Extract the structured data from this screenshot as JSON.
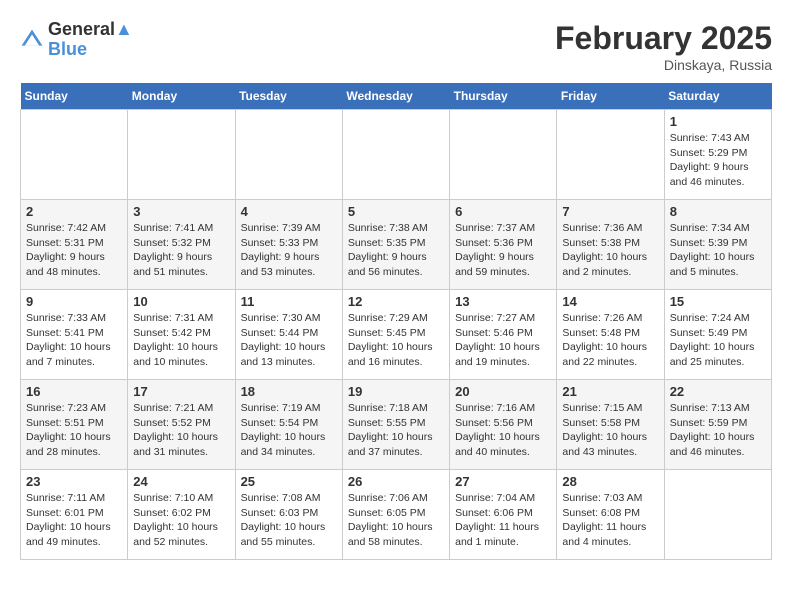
{
  "header": {
    "logo_line1": "General",
    "logo_line2": "Blue",
    "month": "February 2025",
    "location": "Dinskaya, Russia"
  },
  "days_of_week": [
    "Sunday",
    "Monday",
    "Tuesday",
    "Wednesday",
    "Thursday",
    "Friday",
    "Saturday"
  ],
  "weeks": [
    [
      {
        "day": "",
        "info": ""
      },
      {
        "day": "",
        "info": ""
      },
      {
        "day": "",
        "info": ""
      },
      {
        "day": "",
        "info": ""
      },
      {
        "day": "",
        "info": ""
      },
      {
        "day": "",
        "info": ""
      },
      {
        "day": "1",
        "info": "Sunrise: 7:43 AM\nSunset: 5:29 PM\nDaylight: 9 hours and 46 minutes."
      }
    ],
    [
      {
        "day": "2",
        "info": "Sunrise: 7:42 AM\nSunset: 5:31 PM\nDaylight: 9 hours and 48 minutes."
      },
      {
        "day": "3",
        "info": "Sunrise: 7:41 AM\nSunset: 5:32 PM\nDaylight: 9 hours and 51 minutes."
      },
      {
        "day": "4",
        "info": "Sunrise: 7:39 AM\nSunset: 5:33 PM\nDaylight: 9 hours and 53 minutes."
      },
      {
        "day": "5",
        "info": "Sunrise: 7:38 AM\nSunset: 5:35 PM\nDaylight: 9 hours and 56 minutes."
      },
      {
        "day": "6",
        "info": "Sunrise: 7:37 AM\nSunset: 5:36 PM\nDaylight: 9 hours and 59 minutes."
      },
      {
        "day": "7",
        "info": "Sunrise: 7:36 AM\nSunset: 5:38 PM\nDaylight: 10 hours and 2 minutes."
      },
      {
        "day": "8",
        "info": "Sunrise: 7:34 AM\nSunset: 5:39 PM\nDaylight: 10 hours and 5 minutes."
      }
    ],
    [
      {
        "day": "9",
        "info": "Sunrise: 7:33 AM\nSunset: 5:41 PM\nDaylight: 10 hours and 7 minutes."
      },
      {
        "day": "10",
        "info": "Sunrise: 7:31 AM\nSunset: 5:42 PM\nDaylight: 10 hours and 10 minutes."
      },
      {
        "day": "11",
        "info": "Sunrise: 7:30 AM\nSunset: 5:44 PM\nDaylight: 10 hours and 13 minutes."
      },
      {
        "day": "12",
        "info": "Sunrise: 7:29 AM\nSunset: 5:45 PM\nDaylight: 10 hours and 16 minutes."
      },
      {
        "day": "13",
        "info": "Sunrise: 7:27 AM\nSunset: 5:46 PM\nDaylight: 10 hours and 19 minutes."
      },
      {
        "day": "14",
        "info": "Sunrise: 7:26 AM\nSunset: 5:48 PM\nDaylight: 10 hours and 22 minutes."
      },
      {
        "day": "15",
        "info": "Sunrise: 7:24 AM\nSunset: 5:49 PM\nDaylight: 10 hours and 25 minutes."
      }
    ],
    [
      {
        "day": "16",
        "info": "Sunrise: 7:23 AM\nSunset: 5:51 PM\nDaylight: 10 hours and 28 minutes."
      },
      {
        "day": "17",
        "info": "Sunrise: 7:21 AM\nSunset: 5:52 PM\nDaylight: 10 hours and 31 minutes."
      },
      {
        "day": "18",
        "info": "Sunrise: 7:19 AM\nSunset: 5:54 PM\nDaylight: 10 hours and 34 minutes."
      },
      {
        "day": "19",
        "info": "Sunrise: 7:18 AM\nSunset: 5:55 PM\nDaylight: 10 hours and 37 minutes."
      },
      {
        "day": "20",
        "info": "Sunrise: 7:16 AM\nSunset: 5:56 PM\nDaylight: 10 hours and 40 minutes."
      },
      {
        "day": "21",
        "info": "Sunrise: 7:15 AM\nSunset: 5:58 PM\nDaylight: 10 hours and 43 minutes."
      },
      {
        "day": "22",
        "info": "Sunrise: 7:13 AM\nSunset: 5:59 PM\nDaylight: 10 hours and 46 minutes."
      }
    ],
    [
      {
        "day": "23",
        "info": "Sunrise: 7:11 AM\nSunset: 6:01 PM\nDaylight: 10 hours and 49 minutes."
      },
      {
        "day": "24",
        "info": "Sunrise: 7:10 AM\nSunset: 6:02 PM\nDaylight: 10 hours and 52 minutes."
      },
      {
        "day": "25",
        "info": "Sunrise: 7:08 AM\nSunset: 6:03 PM\nDaylight: 10 hours and 55 minutes."
      },
      {
        "day": "26",
        "info": "Sunrise: 7:06 AM\nSunset: 6:05 PM\nDaylight: 10 hours and 58 minutes."
      },
      {
        "day": "27",
        "info": "Sunrise: 7:04 AM\nSunset: 6:06 PM\nDaylight: 11 hours and 1 minute."
      },
      {
        "day": "28",
        "info": "Sunrise: 7:03 AM\nSunset: 6:08 PM\nDaylight: 11 hours and 4 minutes."
      },
      {
        "day": "",
        "info": ""
      }
    ]
  ]
}
